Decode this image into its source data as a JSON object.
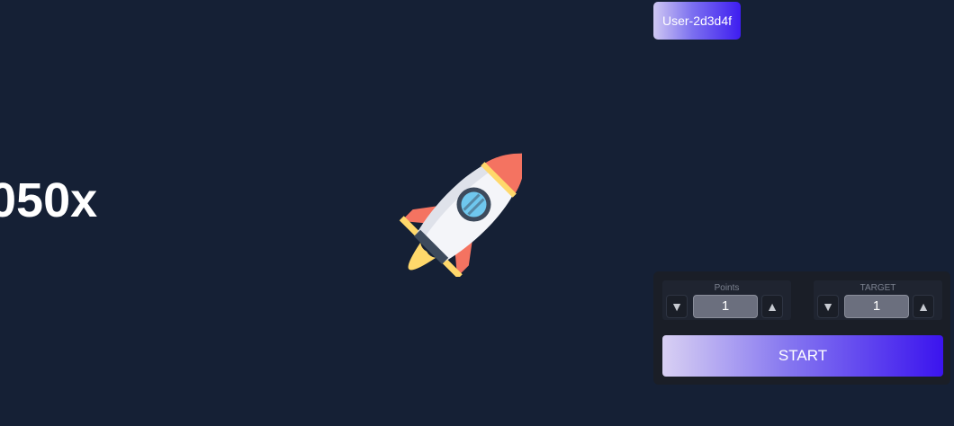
{
  "header": {
    "user_label": "User-2d3d4f"
  },
  "game": {
    "multiplier": "050x",
    "rocket_icon": "rocket-icon"
  },
  "controls": {
    "points": {
      "label": "Points",
      "value": "1",
      "dec_symbol": "▼",
      "inc_symbol": "▲"
    },
    "target": {
      "label": "TARGET",
      "value": "1",
      "dec_symbol": "▼",
      "inc_symbol": "▲"
    },
    "start_label": "START"
  },
  "colors": {
    "background": "#152035",
    "panel": "#1a1e27",
    "accent_start": "#d8d0f3",
    "accent_end": "#3b14ee"
  }
}
